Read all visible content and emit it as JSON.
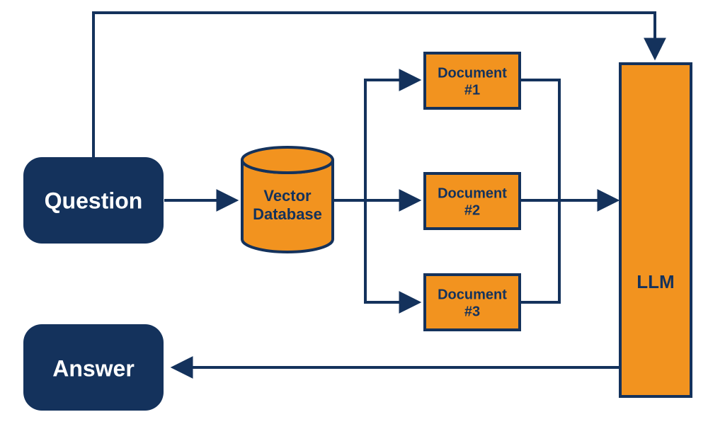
{
  "colors": {
    "navy": "#14325c",
    "orange": "#f2931f",
    "stroke": "#14325c"
  },
  "nodes": {
    "question": {
      "label": "Question"
    },
    "answer": {
      "label": "Answer"
    },
    "vectordb": {
      "line1": "Vector",
      "line2": "Database"
    },
    "doc1": {
      "line1": "Document",
      "line2": "#1"
    },
    "doc2": {
      "line1": "Document",
      "line2": "#2"
    },
    "doc3": {
      "line1": "Document",
      "line2": "#3"
    },
    "llm": {
      "label": "LLM"
    }
  },
  "diagram": {
    "description": "Retrieval-Augmented Generation flow: Question → Vector Database → Documents 1/2/3 → LLM → Answer; Question also feeds LLM directly.",
    "edges": [
      {
        "from": "question",
        "to": "vectordb"
      },
      {
        "from": "vectordb",
        "to": "doc1"
      },
      {
        "from": "vectordb",
        "to": "doc2"
      },
      {
        "from": "vectordb",
        "to": "doc3"
      },
      {
        "from": "doc1",
        "to": "llm"
      },
      {
        "from": "doc2",
        "to": "llm"
      },
      {
        "from": "doc3",
        "to": "llm"
      },
      {
        "from": "question",
        "to": "llm"
      },
      {
        "from": "llm",
        "to": "answer"
      }
    ]
  }
}
